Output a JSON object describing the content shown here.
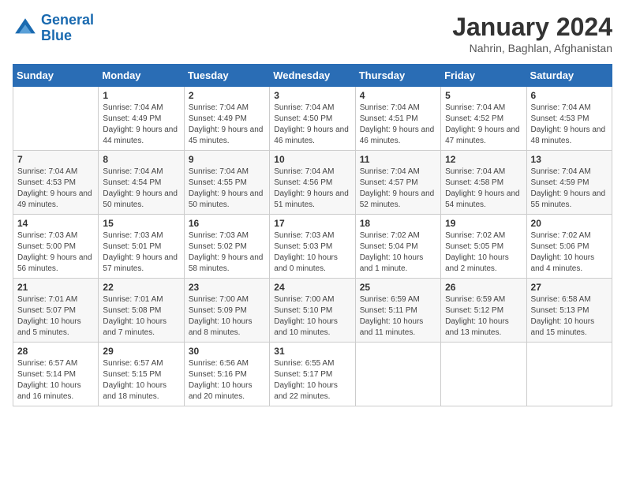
{
  "header": {
    "logo_line1": "General",
    "logo_line2": "Blue",
    "title": "January 2024",
    "subtitle": "Nahrin, Baghlan, Afghanistan"
  },
  "days_of_week": [
    "Sunday",
    "Monday",
    "Tuesday",
    "Wednesday",
    "Thursday",
    "Friday",
    "Saturday"
  ],
  "weeks": [
    [
      {
        "day": "",
        "sunrise": "",
        "sunset": "",
        "daylight": ""
      },
      {
        "day": "1",
        "sunrise": "Sunrise: 7:04 AM",
        "sunset": "Sunset: 4:49 PM",
        "daylight": "Daylight: 9 hours and 44 minutes."
      },
      {
        "day": "2",
        "sunrise": "Sunrise: 7:04 AM",
        "sunset": "Sunset: 4:49 PM",
        "daylight": "Daylight: 9 hours and 45 minutes."
      },
      {
        "day": "3",
        "sunrise": "Sunrise: 7:04 AM",
        "sunset": "Sunset: 4:50 PM",
        "daylight": "Daylight: 9 hours and 46 minutes."
      },
      {
        "day": "4",
        "sunrise": "Sunrise: 7:04 AM",
        "sunset": "Sunset: 4:51 PM",
        "daylight": "Daylight: 9 hours and 46 minutes."
      },
      {
        "day": "5",
        "sunrise": "Sunrise: 7:04 AM",
        "sunset": "Sunset: 4:52 PM",
        "daylight": "Daylight: 9 hours and 47 minutes."
      },
      {
        "day": "6",
        "sunrise": "Sunrise: 7:04 AM",
        "sunset": "Sunset: 4:53 PM",
        "daylight": "Daylight: 9 hours and 48 minutes."
      }
    ],
    [
      {
        "day": "7",
        "sunrise": "Sunrise: 7:04 AM",
        "sunset": "Sunset: 4:53 PM",
        "daylight": "Daylight: 9 hours and 49 minutes."
      },
      {
        "day": "8",
        "sunrise": "Sunrise: 7:04 AM",
        "sunset": "Sunset: 4:54 PM",
        "daylight": "Daylight: 9 hours and 50 minutes."
      },
      {
        "day": "9",
        "sunrise": "Sunrise: 7:04 AM",
        "sunset": "Sunset: 4:55 PM",
        "daylight": "Daylight: 9 hours and 50 minutes."
      },
      {
        "day": "10",
        "sunrise": "Sunrise: 7:04 AM",
        "sunset": "Sunset: 4:56 PM",
        "daylight": "Daylight: 9 hours and 51 minutes."
      },
      {
        "day": "11",
        "sunrise": "Sunrise: 7:04 AM",
        "sunset": "Sunset: 4:57 PM",
        "daylight": "Daylight: 9 hours and 52 minutes."
      },
      {
        "day": "12",
        "sunrise": "Sunrise: 7:04 AM",
        "sunset": "Sunset: 4:58 PM",
        "daylight": "Daylight: 9 hours and 54 minutes."
      },
      {
        "day": "13",
        "sunrise": "Sunrise: 7:04 AM",
        "sunset": "Sunset: 4:59 PM",
        "daylight": "Daylight: 9 hours and 55 minutes."
      }
    ],
    [
      {
        "day": "14",
        "sunrise": "Sunrise: 7:03 AM",
        "sunset": "Sunset: 5:00 PM",
        "daylight": "Daylight: 9 hours and 56 minutes."
      },
      {
        "day": "15",
        "sunrise": "Sunrise: 7:03 AM",
        "sunset": "Sunset: 5:01 PM",
        "daylight": "Daylight: 9 hours and 57 minutes."
      },
      {
        "day": "16",
        "sunrise": "Sunrise: 7:03 AM",
        "sunset": "Sunset: 5:02 PM",
        "daylight": "Daylight: 9 hours and 58 minutes."
      },
      {
        "day": "17",
        "sunrise": "Sunrise: 7:03 AM",
        "sunset": "Sunset: 5:03 PM",
        "daylight": "Daylight: 10 hours and 0 minutes."
      },
      {
        "day": "18",
        "sunrise": "Sunrise: 7:02 AM",
        "sunset": "Sunset: 5:04 PM",
        "daylight": "Daylight: 10 hours and 1 minute."
      },
      {
        "day": "19",
        "sunrise": "Sunrise: 7:02 AM",
        "sunset": "Sunset: 5:05 PM",
        "daylight": "Daylight: 10 hours and 2 minutes."
      },
      {
        "day": "20",
        "sunrise": "Sunrise: 7:02 AM",
        "sunset": "Sunset: 5:06 PM",
        "daylight": "Daylight: 10 hours and 4 minutes."
      }
    ],
    [
      {
        "day": "21",
        "sunrise": "Sunrise: 7:01 AM",
        "sunset": "Sunset: 5:07 PM",
        "daylight": "Daylight: 10 hours and 5 minutes."
      },
      {
        "day": "22",
        "sunrise": "Sunrise: 7:01 AM",
        "sunset": "Sunset: 5:08 PM",
        "daylight": "Daylight: 10 hours and 7 minutes."
      },
      {
        "day": "23",
        "sunrise": "Sunrise: 7:00 AM",
        "sunset": "Sunset: 5:09 PM",
        "daylight": "Daylight: 10 hours and 8 minutes."
      },
      {
        "day": "24",
        "sunrise": "Sunrise: 7:00 AM",
        "sunset": "Sunset: 5:10 PM",
        "daylight": "Daylight: 10 hours and 10 minutes."
      },
      {
        "day": "25",
        "sunrise": "Sunrise: 6:59 AM",
        "sunset": "Sunset: 5:11 PM",
        "daylight": "Daylight: 10 hours and 11 minutes."
      },
      {
        "day": "26",
        "sunrise": "Sunrise: 6:59 AM",
        "sunset": "Sunset: 5:12 PM",
        "daylight": "Daylight: 10 hours and 13 minutes."
      },
      {
        "day": "27",
        "sunrise": "Sunrise: 6:58 AM",
        "sunset": "Sunset: 5:13 PM",
        "daylight": "Daylight: 10 hours and 15 minutes."
      }
    ],
    [
      {
        "day": "28",
        "sunrise": "Sunrise: 6:57 AM",
        "sunset": "Sunset: 5:14 PM",
        "daylight": "Daylight: 10 hours and 16 minutes."
      },
      {
        "day": "29",
        "sunrise": "Sunrise: 6:57 AM",
        "sunset": "Sunset: 5:15 PM",
        "daylight": "Daylight: 10 hours and 18 minutes."
      },
      {
        "day": "30",
        "sunrise": "Sunrise: 6:56 AM",
        "sunset": "Sunset: 5:16 PM",
        "daylight": "Daylight: 10 hours and 20 minutes."
      },
      {
        "day": "31",
        "sunrise": "Sunrise: 6:55 AM",
        "sunset": "Sunset: 5:17 PM",
        "daylight": "Daylight: 10 hours and 22 minutes."
      },
      {
        "day": "",
        "sunrise": "",
        "sunset": "",
        "daylight": ""
      },
      {
        "day": "",
        "sunrise": "",
        "sunset": "",
        "daylight": ""
      },
      {
        "day": "",
        "sunrise": "",
        "sunset": "",
        "daylight": ""
      }
    ]
  ]
}
